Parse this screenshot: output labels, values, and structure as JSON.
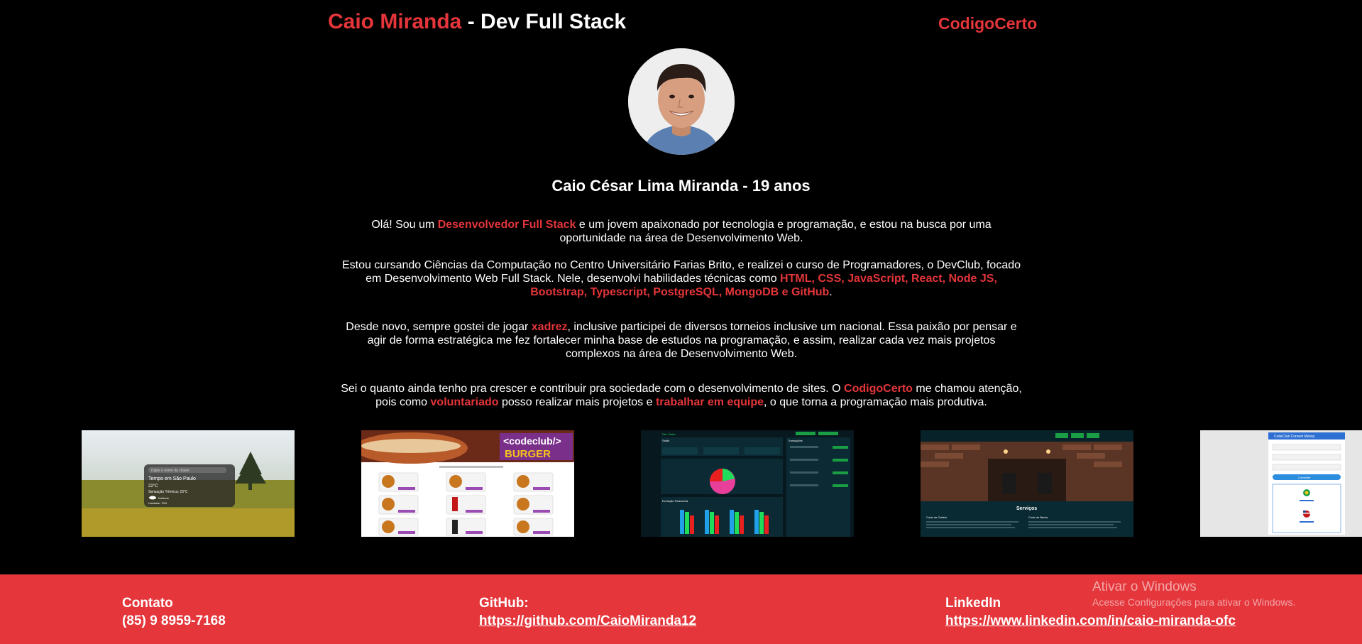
{
  "header": {
    "title_name": "Caio Miranda",
    "title_rest": " - Dev Full Stack",
    "brand_link": "CodigoCerto"
  },
  "profile": {
    "name": "Caio César Lima Miranda - 19 anos"
  },
  "bio": {
    "p1": {
      "a": "Olá! Sou um ",
      "b": "Desenvolvedor Full Stack",
      "c": " e um jovem apaixonado por tecnologia e programação, e estou na busca por uma oportunidade na área de Desenvolvimento Web."
    },
    "p2": {
      "a": "Estou cursando Ciências da Computação no Centro Universitário Farias Brito, e realizei o curso de Programadores, o DevClub, focado em Desenvolvimento Web Full Stack. Nele, desenvolvi habilidades técnicas como ",
      "b": "HTML, CSS, JavaScript, React, Node JS, Bootstrap, Typescript, PostgreSQL, MongoDB e GitHub",
      "c": "."
    },
    "p3": {
      "a": "Desde novo, sempre gostei de jogar ",
      "b": "xadrez",
      "c": ", inclusive participei de diversos torneios inclusive um nacional. Essa paixão por pensar e agir de forma estratégica me fez fortalecer minha base de estudos na programação, e assim, realizar cada vez mais projetos complexos na área de Desenvolvimento Web."
    },
    "p4": {
      "a": "Sei o quanto ainda tenho pra crescer e contribuir pra sociedade com o desenvolvimento de sites. O ",
      "b": "CodigoCerto",
      "c": " me chamou atenção, pois como ",
      "d": "voluntariado",
      "e": " posso realizar mais projetos e ",
      "f": "trabalhar em equipe",
      "g": ", o que torna a programação mais produtiva."
    }
  },
  "projects": {
    "weather": {
      "search_placeholder": "Digite o nome da cidade",
      "line1": "Tempo em São Paulo",
      "line2": "22°C",
      "line3": "Sensação Térmica: 23°C",
      "line4": "Nublado",
      "line5": "Umidade: 70%"
    },
    "burger": {
      "logo": "<codeclub/>",
      "logo_sub": "BURGER"
    },
    "finance": {
      "brand": "Dev Clube",
      "title": "Saldo",
      "chart_title": "Evolução Financeira",
      "transactions_title": "Transações"
    },
    "barber": {
      "section_title": "Serviços",
      "service1": "Corte de Cabelo",
      "service2": "Corte de Barba"
    },
    "converter": {
      "title": "CodeClub Convert Money",
      "button": "Converter"
    }
  },
  "footer": {
    "contact_label": "Contato",
    "contact_value": "(85) 9 8959-7168",
    "github_label": "GitHub:",
    "github_url": "https://github.com/CaioMiranda12",
    "linkedin_label": "LinkedIn",
    "linkedin_url": "https://www.linkedin.com/in/caio-miranda-ofc"
  },
  "watermark": {
    "title": "Ativar o Windows",
    "subtitle": "Acesse Configurações para ativar o Windows."
  },
  "colors": {
    "accent": "#e4353a",
    "background": "#000000",
    "footer": "#e4363b"
  }
}
